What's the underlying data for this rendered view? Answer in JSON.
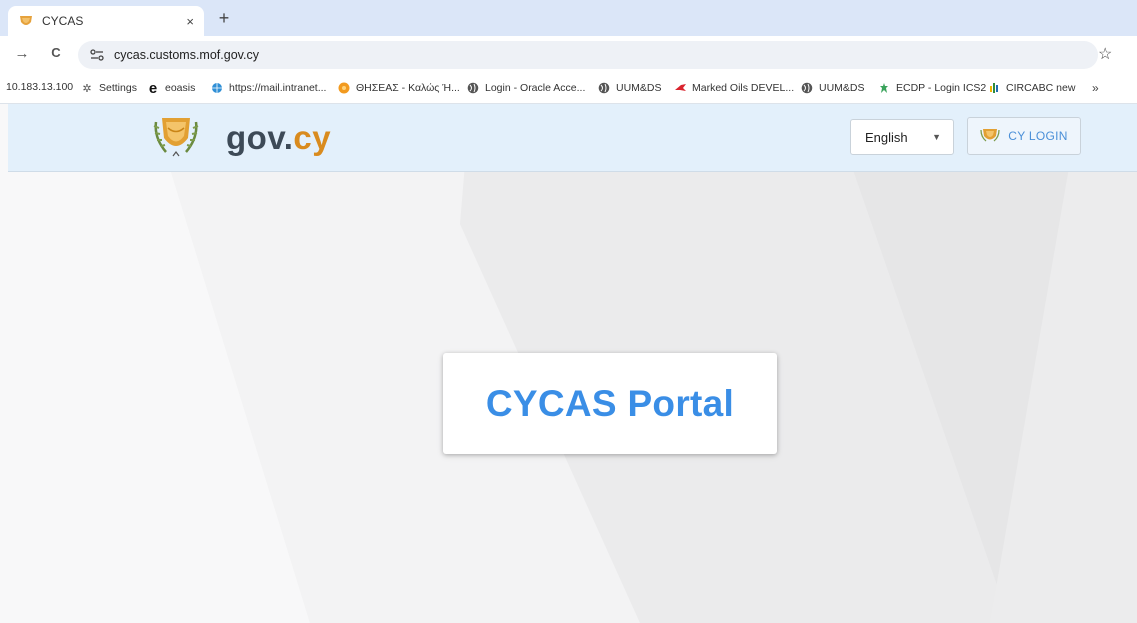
{
  "browser": {
    "tab_title": "CYCAS",
    "tab_close": "×",
    "new_tab": "+",
    "back": "→",
    "reload": "C",
    "url": "cycas.customs.mof.gov.cy",
    "star": "☆",
    "bookmarks": [
      {
        "label": "10.183.13.100",
        "icon": "none"
      },
      {
        "label": "Settings",
        "icon": "gear-icon"
      },
      {
        "label": "eoasis",
        "icon": "e-icon"
      },
      {
        "label": "https://mail.intranet...",
        "icon": "globe-blue-icon"
      },
      {
        "label": "ΘΗΣΕΑΣ - Καλώς Ή...",
        "icon": "orange-circle-icon"
      },
      {
        "label": "Login - Oracle Acce...",
        "icon": "globe-icon"
      },
      {
        "label": "UUM&DS",
        "icon": "globe-icon"
      },
      {
        "label": "Marked Oils DEVEL...",
        "icon": "red-bird-icon"
      },
      {
        "label": "UUM&DS",
        "icon": "globe-icon"
      },
      {
        "label": "ECDP - Login ICS2",
        "icon": "green-tower-icon"
      },
      {
        "label": "CIRCABC new",
        "icon": "circabc-icon"
      }
    ],
    "more_bookmarks": "»"
  },
  "header": {
    "brand_gov": "gov.",
    "brand_cy": "cy",
    "language": "English",
    "login_label": "CY LOGIN"
  },
  "main": {
    "card_title": "CYCAS Portal"
  },
  "colors": {
    "header_bg": "#e3f0fb",
    "brand_dark": "#3d4a57",
    "brand_orange": "#d98b1e",
    "accent_blue": "#3a8ee6"
  }
}
